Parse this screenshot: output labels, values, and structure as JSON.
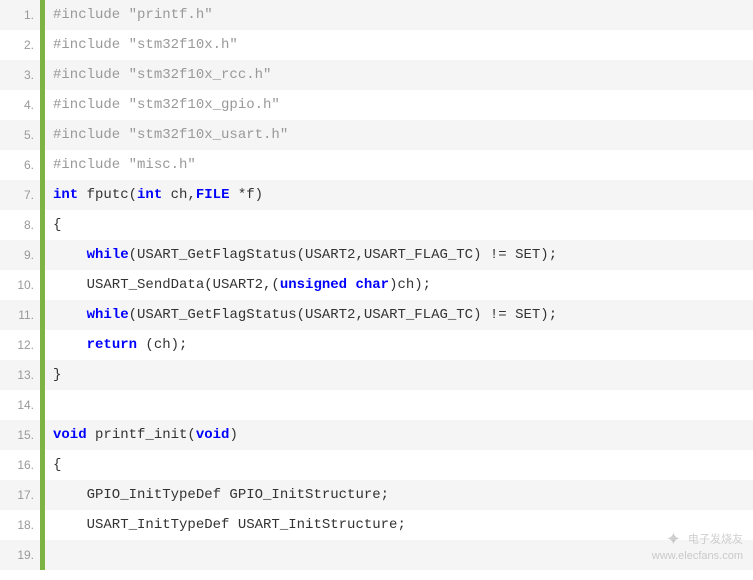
{
  "lines": [
    {
      "num": "1.",
      "alt": true,
      "segments": [
        {
          "cls": "comment",
          "text": "#include \"printf.h\""
        }
      ]
    },
    {
      "num": "2.",
      "alt": false,
      "segments": [
        {
          "cls": "comment",
          "text": "#include \"stm32f10x.h\""
        }
      ]
    },
    {
      "num": "3.",
      "alt": true,
      "segments": [
        {
          "cls": "comment",
          "text": "#include \"stm32f10x_rcc.h\""
        }
      ]
    },
    {
      "num": "4.",
      "alt": false,
      "segments": [
        {
          "cls": "comment",
          "text": "#include \"stm32f10x_gpio.h\""
        }
      ]
    },
    {
      "num": "5.",
      "alt": true,
      "segments": [
        {
          "cls": "comment",
          "text": "#include \"stm32f10x_usart.h\""
        }
      ]
    },
    {
      "num": "6.",
      "alt": false,
      "segments": [
        {
          "cls": "comment",
          "text": "#include \"misc.h\""
        }
      ]
    },
    {
      "num": "7.",
      "alt": true,
      "segments": [
        {
          "cls": "keyword",
          "text": "int"
        },
        {
          "cls": "plain",
          "text": " fputc("
        },
        {
          "cls": "keyword",
          "text": "int"
        },
        {
          "cls": "plain",
          "text": " ch,"
        },
        {
          "cls": "keyword",
          "text": "FILE"
        },
        {
          "cls": "plain",
          "text": " *f)"
        }
      ]
    },
    {
      "num": "8.",
      "alt": false,
      "segments": [
        {
          "cls": "plain",
          "text": "{"
        }
      ]
    },
    {
      "num": "9.",
      "alt": true,
      "segments": [
        {
          "cls": "plain",
          "text": "    "
        },
        {
          "cls": "keyword",
          "text": "while"
        },
        {
          "cls": "plain",
          "text": "(USART_GetFlagStatus(USART2,USART_FLAG_TC) != SET);"
        }
      ]
    },
    {
      "num": "10.",
      "alt": false,
      "segments": [
        {
          "cls": "plain",
          "text": "    USART_SendData(USART2,("
        },
        {
          "cls": "keyword",
          "text": "unsigned"
        },
        {
          "cls": "plain",
          "text": " "
        },
        {
          "cls": "keyword",
          "text": "char"
        },
        {
          "cls": "plain",
          "text": ")ch);"
        }
      ]
    },
    {
      "num": "11.",
      "alt": true,
      "segments": [
        {
          "cls": "plain",
          "text": "    "
        },
        {
          "cls": "keyword",
          "text": "while"
        },
        {
          "cls": "plain",
          "text": "(USART_GetFlagStatus(USART2,USART_FLAG_TC) != SET);"
        }
      ]
    },
    {
      "num": "12.",
      "alt": false,
      "segments": [
        {
          "cls": "plain",
          "text": "    "
        },
        {
          "cls": "keyword",
          "text": "return"
        },
        {
          "cls": "plain",
          "text": " (ch);"
        }
      ]
    },
    {
      "num": "13.",
      "alt": true,
      "segments": [
        {
          "cls": "plain",
          "text": "}"
        }
      ]
    },
    {
      "num": "14.",
      "alt": false,
      "segments": [
        {
          "cls": "plain",
          "text": " "
        }
      ]
    },
    {
      "num": "15.",
      "alt": true,
      "segments": [
        {
          "cls": "keyword",
          "text": "void"
        },
        {
          "cls": "plain",
          "text": " printf_init("
        },
        {
          "cls": "keyword",
          "text": "void"
        },
        {
          "cls": "plain",
          "text": ")"
        }
      ]
    },
    {
      "num": "16.",
      "alt": false,
      "segments": [
        {
          "cls": "plain",
          "text": "{"
        }
      ]
    },
    {
      "num": "17.",
      "alt": true,
      "segments": [
        {
          "cls": "plain",
          "text": "    GPIO_InitTypeDef GPIO_InitStructure;"
        }
      ]
    },
    {
      "num": "18.",
      "alt": false,
      "segments": [
        {
          "cls": "plain",
          "text": "    USART_InitTypeDef USART_InitStructure;"
        }
      ]
    },
    {
      "num": "19.",
      "alt": true,
      "segments": [
        {
          "cls": "plain",
          "text": " "
        }
      ]
    }
  ],
  "watermark": {
    "brand": "电子发烧友",
    "url": "www.elecfans.com"
  }
}
